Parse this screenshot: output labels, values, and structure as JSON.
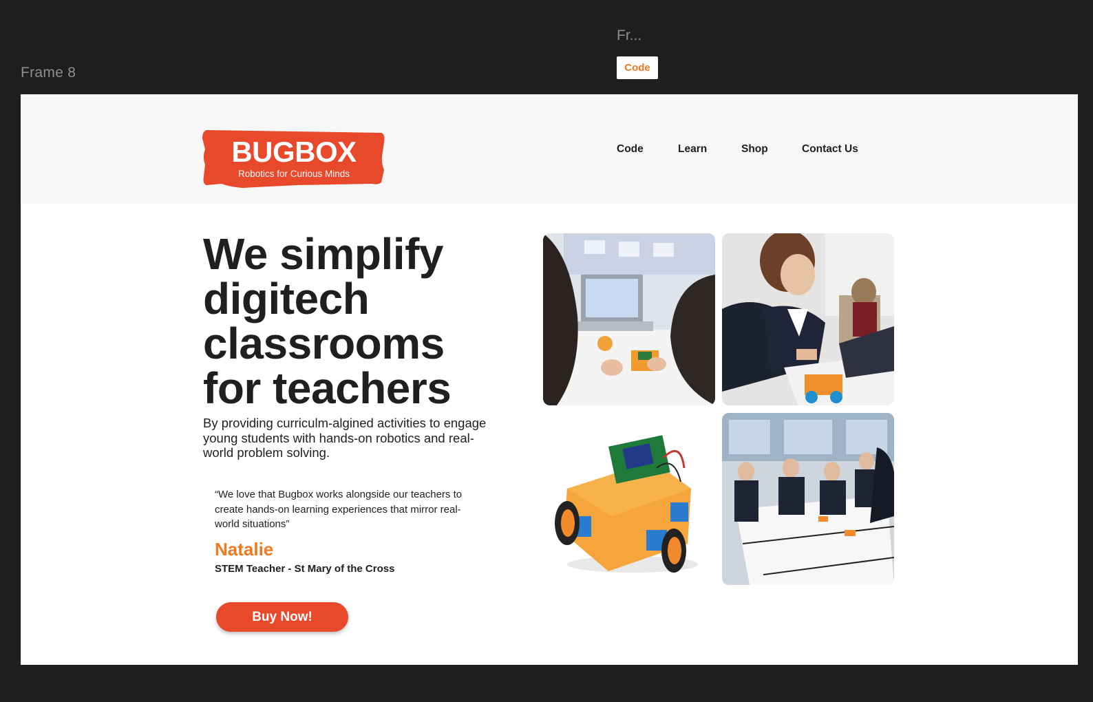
{
  "editor": {
    "frame_label": "Frame 8",
    "frame2_label": "Fr...",
    "frame2_chip": "Code"
  },
  "logo": {
    "brand": "BUGBOX",
    "tagline": "Robotics for Curious Minds",
    "color": "#e8492a"
  },
  "nav": {
    "items": [
      {
        "label": "Code"
      },
      {
        "label": "Learn"
      },
      {
        "label": "Shop"
      },
      {
        "label": "Contact Us"
      }
    ]
  },
  "hero": {
    "title_lines": [
      "We simplify",
      "digitech",
      "classrooms",
      "for teachers"
    ],
    "subtitle": "By providing curriculm-algined activities to engage young students with hands-on robotics and real-world problem solving."
  },
  "testimonial": {
    "quote": "“We love that Bugbox works alongside our teachers to create hands-on learning experiences that mirror real-world situations”",
    "name": "Natalie",
    "role": "STEM Teacher - St Mary of the Cross"
  },
  "cta": {
    "label": "Buy Now!"
  },
  "colors": {
    "accent": "#e8492a",
    "highlight": "#ee7a22",
    "text": "#1f1f1f",
    "header_bg": "#f7f7f7",
    "editor_bg": "#1e1e1e"
  },
  "photos": [
    {
      "icon": "students-with-laptop-photo"
    },
    {
      "icon": "student-building-robot-photo"
    },
    {
      "icon": "orange-robot-car-photo"
    },
    {
      "icon": "students-at-table-photo"
    }
  ]
}
